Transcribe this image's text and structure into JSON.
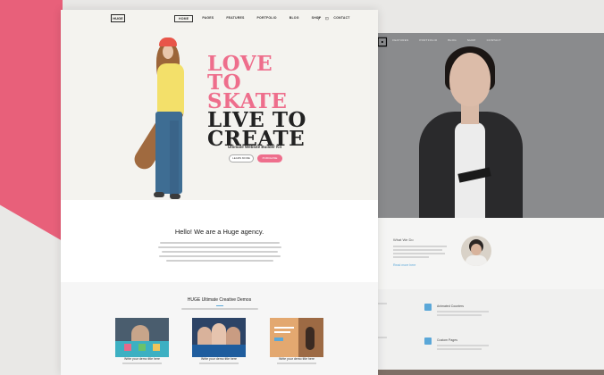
{
  "front": {
    "logo": "HUGE",
    "nav": [
      "HOME",
      "PAGES",
      "FEATURES",
      "PORTFOLIO",
      "BLOG",
      "SHOP",
      "CONTACT"
    ],
    "hero_line1": "LOVE TO",
    "hero_line2": "SKATE",
    "hero_line3": "LIVE TO",
    "hero_line4": "CREATE",
    "subtitle": "Ultimate Website Builder Kit",
    "learn_label": "LEARN MORE",
    "purchase_label": "PURCHASE",
    "agency_title": "Hello! We are a Huge agency.",
    "demos_title": "HUGE Ultimate Creative Demos",
    "demos": [
      {
        "caption": "Write your demo title here"
      },
      {
        "caption": "Write your demo title here"
      },
      {
        "caption": "Write your demo title here"
      }
    ]
  },
  "back": {
    "nav": [
      "FEATURES",
      "PORTFOLIO",
      "BLOG",
      "SHOP",
      "CONTACT"
    ],
    "what_title": "What We Do",
    "read_more": "Read more here",
    "features": [
      "Animated Counters",
      "Custom Pages"
    ]
  },
  "colors": {
    "accent_pink": "#ee6e8c",
    "accent_blue": "#5aa7d8",
    "wedge": "#e8607a"
  }
}
